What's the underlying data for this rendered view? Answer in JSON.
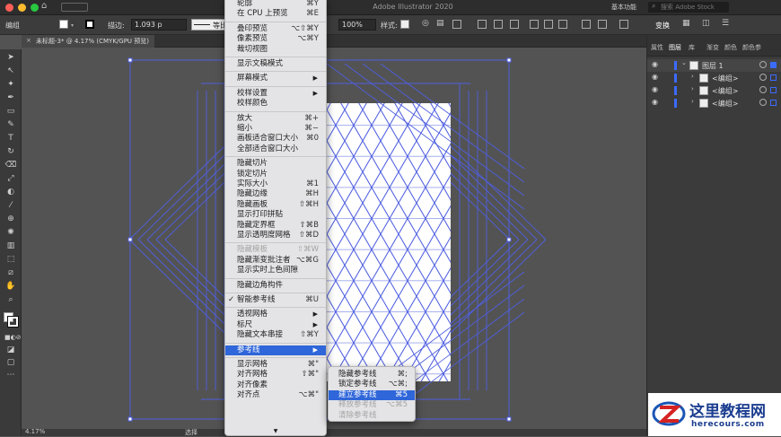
{
  "app": {
    "title": "Adobe Illustrator 2020",
    "workspace": "基本功能",
    "search_placeholder": "搜索 Adobe Stock"
  },
  "control_bar": {
    "selection_label": "编组",
    "stroke_label": "描边:",
    "stroke_value": "1.093 p",
    "stroke_style": "等比",
    "opacity_value": "100%",
    "style_label": "样式:",
    "transform_label": "变换"
  },
  "document": {
    "tab_label": "未标题-3* @ 4.17% (CMYK/GPU 预览)",
    "zoom": "4.17%",
    "status": "选择"
  },
  "view_menu": [
    {
      "label": "轮廓",
      "shortcut": "⌘Y",
      "disabled": false
    },
    {
      "label": "在 CPU 上预览",
      "shortcut": "⌘E",
      "disabled": false
    },
    {
      "sep": true
    },
    {
      "label": "叠印预览",
      "shortcut": "⌥⇧⌘Y",
      "disabled": false
    },
    {
      "label": "像素预览",
      "shortcut": "⌥⌘Y",
      "disabled": false
    },
    {
      "label": "裁切视图",
      "shortcut": "",
      "disabled": false
    },
    {
      "sep": true
    },
    {
      "label": "显示文稿模式",
      "shortcut": "",
      "disabled": false
    },
    {
      "sep": true
    },
    {
      "label": "屏幕模式",
      "shortcut": "",
      "submenu": true,
      "disabled": false
    },
    {
      "sep": true
    },
    {
      "label": "校样设置",
      "shortcut": "",
      "submenu": true,
      "disabled": false
    },
    {
      "label": "校样颜色",
      "shortcut": "",
      "disabled": false
    },
    {
      "sep": true
    },
    {
      "label": "放大",
      "shortcut": "⌘+",
      "disabled": false
    },
    {
      "label": "缩小",
      "shortcut": "⌘−",
      "disabled": false
    },
    {
      "label": "画板适合窗口大小",
      "shortcut": "⌘0",
      "disabled": false
    },
    {
      "label": "全部适合窗口大小",
      "shortcut": "",
      "disabled": false
    },
    {
      "sep": true
    },
    {
      "label": "隐藏切片",
      "shortcut": "",
      "disabled": false
    },
    {
      "label": "锁定切片",
      "shortcut": "",
      "disabled": false
    },
    {
      "label": "实际大小",
      "shortcut": "⌘1",
      "disabled": false
    },
    {
      "label": "隐藏边缘",
      "shortcut": "⌘H",
      "disabled": false
    },
    {
      "label": "隐藏画板",
      "shortcut": "⇧⌘H",
      "disabled": false
    },
    {
      "label": "显示打印拼贴",
      "shortcut": "",
      "disabled": false
    },
    {
      "label": "隐藏定界框",
      "shortcut": "⇧⌘B",
      "disabled": false
    },
    {
      "label": "显示透明度网格",
      "shortcut": "⇧⌘D",
      "disabled": false
    },
    {
      "sep": true
    },
    {
      "label": "隐藏模板",
      "shortcut": "⇧⌘W",
      "disabled": true
    },
    {
      "label": "隐藏渐变批注者",
      "shortcut": "⌥⌘G",
      "disabled": false
    },
    {
      "label": "显示实时上色间隙",
      "shortcut": "",
      "disabled": false
    },
    {
      "sep": true
    },
    {
      "label": "隐藏边角构件",
      "shortcut": "",
      "disabled": false
    },
    {
      "sep": true
    },
    {
      "label": "智能参考线",
      "shortcut": "⌘U",
      "checked": true,
      "disabled": false
    },
    {
      "sep": true
    },
    {
      "label": "透视网格",
      "shortcut": "",
      "submenu": true,
      "disabled": false
    },
    {
      "label": "标尺",
      "shortcut": "",
      "submenu": true,
      "disabled": false
    },
    {
      "label": "隐藏文本串接",
      "shortcut": "⇧⌘Y",
      "disabled": false
    },
    {
      "sep": true
    },
    {
      "label": "参考线",
      "shortcut": "",
      "submenu": true,
      "highlighted": true,
      "disabled": false
    },
    {
      "sep": true
    },
    {
      "label": "显示网格",
      "shortcut": "⌘\"",
      "disabled": false
    },
    {
      "label": "对齐网格",
      "shortcut": "⇧⌘\"",
      "disabled": false
    },
    {
      "label": "对齐像素",
      "shortcut": "",
      "disabled": false
    },
    {
      "label": "对齐点",
      "shortcut": "⌥⌘\"",
      "disabled": false
    }
  ],
  "guides_submenu": [
    {
      "label": "隐藏参考线",
      "shortcut": "⌘;",
      "disabled": false
    },
    {
      "label": "锁定参考线",
      "shortcut": "⌥⌘;",
      "disabled": false
    },
    {
      "label": "建立参考线",
      "shortcut": "⌘5",
      "highlighted": true,
      "disabled": false
    },
    {
      "label": "释放参考线",
      "shortcut": "⌥⌘5",
      "disabled": true
    },
    {
      "label": "清除参考线",
      "shortcut": "",
      "disabled": true
    }
  ],
  "panel": {
    "tabs": [
      "属性",
      "图层",
      "库",
      "渐变",
      "颜色",
      "颜色参"
    ],
    "layers": [
      {
        "name": "图层 1"
      },
      {
        "name": "<编组>"
      },
      {
        "name": "<编组>"
      },
      {
        "name": "<编组>"
      }
    ]
  },
  "watermark": {
    "title": "这里教程网",
    "url": "herecours.com"
  },
  "colors": {
    "guide_blue": "#4f5fe0",
    "menu_highlight": "#2f66d9",
    "layer_color": "#3b6bff"
  }
}
